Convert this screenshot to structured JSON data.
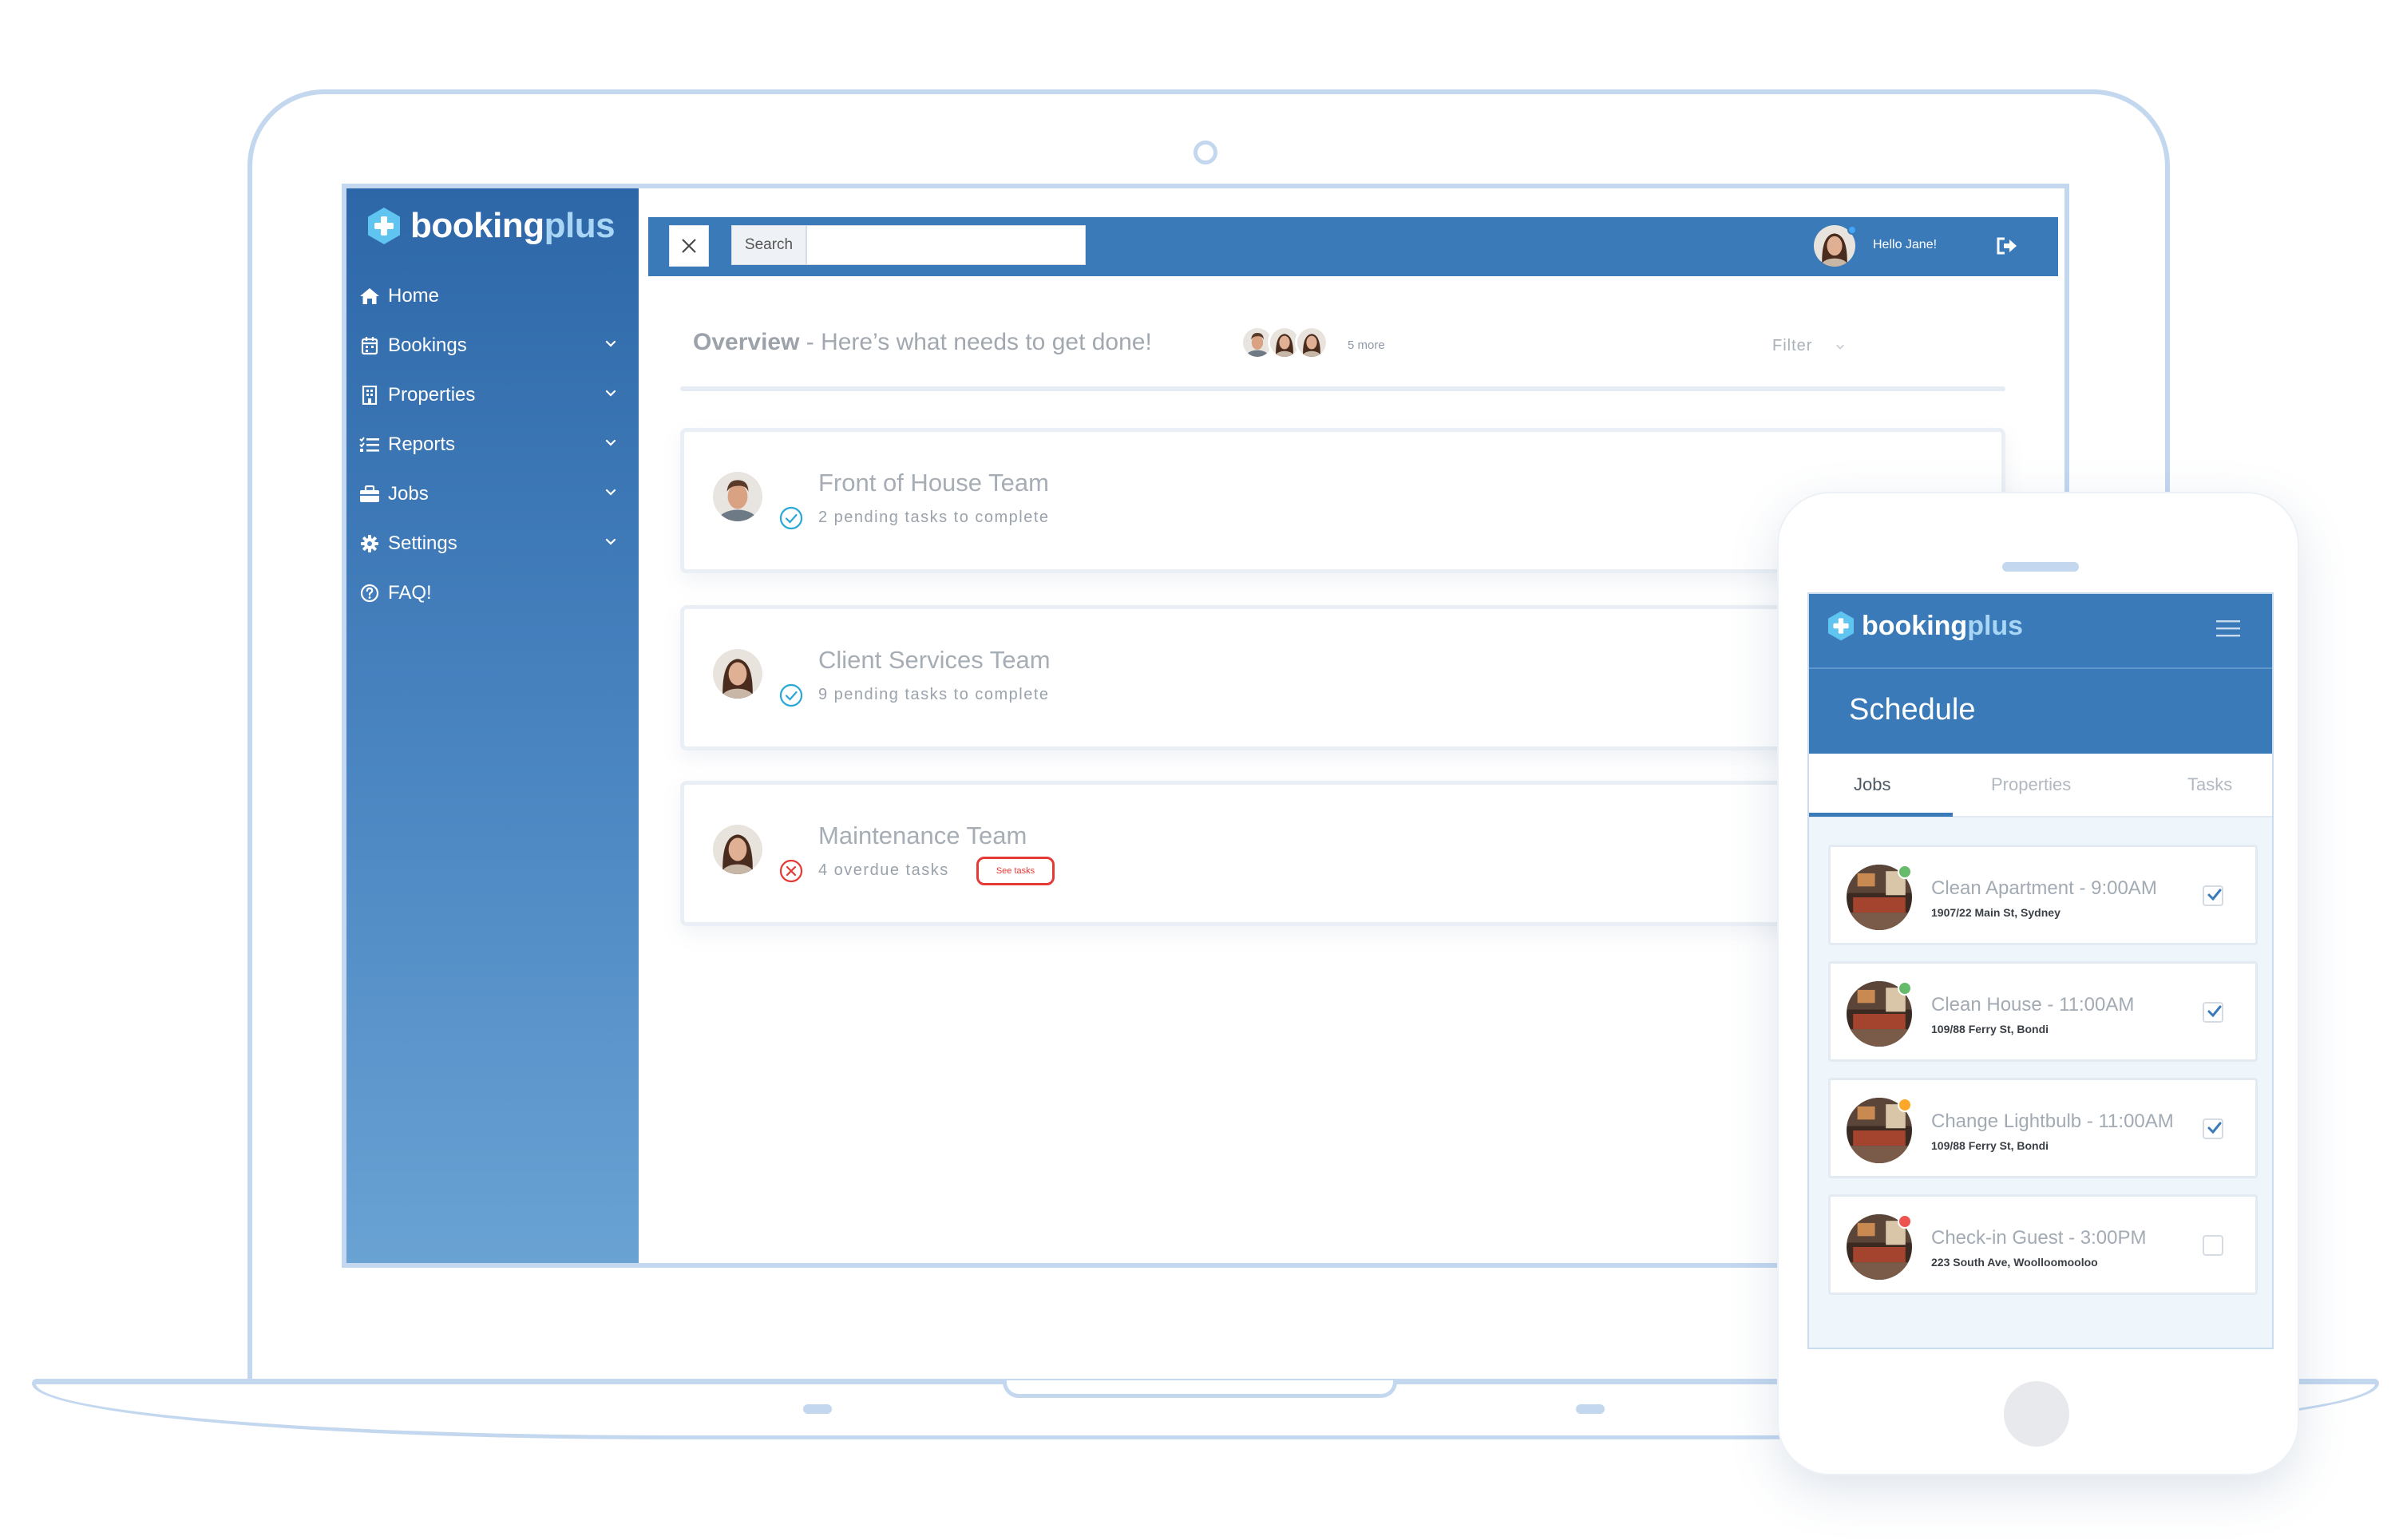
{
  "brand": {
    "name_main": "booking",
    "name_accent": "plus"
  },
  "sidebar": {
    "items": [
      {
        "label": "Home",
        "icon": "home-icon",
        "has_submenu": false
      },
      {
        "label": "Bookings",
        "icon": "calendar-icon",
        "has_submenu": true
      },
      {
        "label": "Properties",
        "icon": "building-icon",
        "has_submenu": true
      },
      {
        "label": "Reports",
        "icon": "list-icon",
        "has_submenu": true
      },
      {
        "label": "Jobs",
        "icon": "briefcase-icon",
        "has_submenu": true
      },
      {
        "label": "Settings",
        "icon": "gear-icon",
        "has_submenu": true
      },
      {
        "label": "FAQ!",
        "icon": "question-circle-icon",
        "has_submenu": false
      }
    ]
  },
  "topbar": {
    "search_label": "Search",
    "search_value": "",
    "greeting": "Hello Jane!",
    "presence_color": "#42a5f5"
  },
  "overview": {
    "title_bold": "Overview",
    "title_rest": " - Here’s what needs to get done!",
    "more_label": "5 more",
    "filter_label": "Filter"
  },
  "teams": [
    {
      "name": "Front of House Team",
      "subtitle": "2 pending tasks to complete",
      "status": "complete",
      "action": ""
    },
    {
      "name": "Client Services Team",
      "subtitle": "9 pending tasks to complete",
      "status": "complete",
      "action": ""
    },
    {
      "name": "Maintenance Team",
      "subtitle": "4 overdue tasks",
      "status": "overdue",
      "action": "See tasks"
    }
  ],
  "mobile": {
    "screen_title": "Schedule",
    "tabs": [
      {
        "label": "Jobs",
        "active": true
      },
      {
        "label": "Properties",
        "active": false
      },
      {
        "label": "Tasks",
        "active": false
      }
    ],
    "jobs": [
      {
        "title": "Clean Apartment - 9:00AM",
        "address": "1907/22 Main St, Sydney",
        "status_color": "#66bb6a",
        "checked": true
      },
      {
        "title": "Clean House - 11:00AM",
        "address": "109/88 Ferry St, Bondi",
        "status_color": "#66bb6a",
        "checked": true
      },
      {
        "title": "Change Lightbulb - 11:00AM",
        "address": "109/88 Ferry St, Bondi",
        "status_color": "#ffa726",
        "checked": true
      },
      {
        "title": "Check-in Guest - 3:00PM",
        "address": "223 South Ave, Woolloomooloo",
        "status_color": "#ef5350",
        "checked": false
      }
    ]
  },
  "colors": {
    "primary": "#3a7ab8",
    "sidebar_top": "#2d67a8",
    "sidebar_bottom": "#69a2d3",
    "device_outline": "#c3d7ef",
    "success": "#29a8d8",
    "danger": "#e53935"
  }
}
